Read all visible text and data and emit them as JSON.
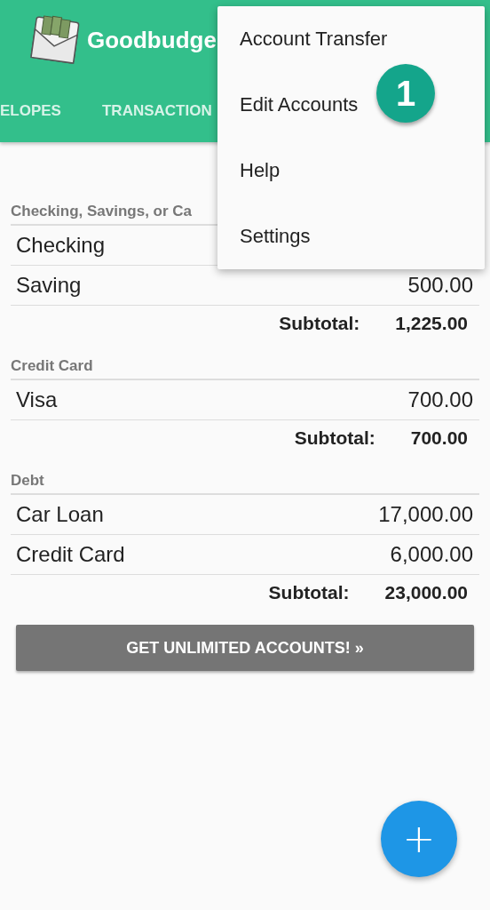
{
  "app_bar": {
    "title": "Goodbudge"
  },
  "tabs": [
    {
      "label": "ELOPES",
      "selected": false
    },
    {
      "label": "TRANSACTION",
      "selected": false
    }
  ],
  "sections": [
    {
      "title": "Checking, Savings, or Ca",
      "accounts": [
        {
          "name": "Checking"
        },
        {
          "name": "Saving",
          "amount": "500.00"
        }
      ],
      "subtotal_label": "Subtotal:",
      "subtotal": "1,225.00"
    },
    {
      "title": "Credit Card",
      "accounts": [
        {
          "name": "Visa",
          "amount": "700.00"
        }
      ],
      "subtotal_label": "Subtotal:",
      "subtotal": "700.00"
    },
    {
      "title": "Debt",
      "accounts": [
        {
          "name": "Car Loan",
          "amount": "17,000.00"
        },
        {
          "name": "Credit Card",
          "amount": "6,000.00"
        }
      ],
      "subtotal_label": "Subtotal:",
      "subtotal": "23,000.00"
    }
  ],
  "upgrade_button": "GET UNLIMITED ACCOUNTS! »",
  "menu": {
    "items": [
      {
        "label": "Account Transfer"
      },
      {
        "label": "Edit Accounts"
      },
      {
        "label": "Help"
      },
      {
        "label": "Settings"
      }
    ]
  },
  "step_badge": "1",
  "fab": "+"
}
